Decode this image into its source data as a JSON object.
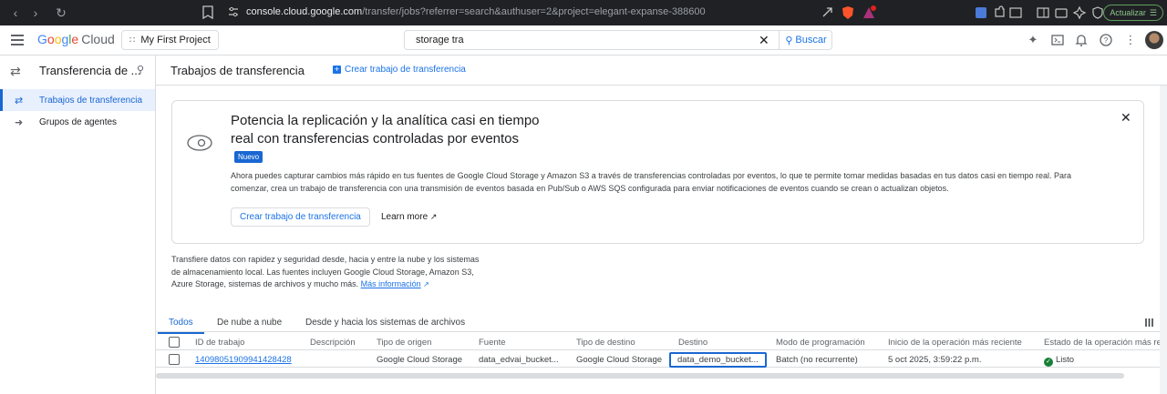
{
  "browser": {
    "url_host": "console.cloud.google.com",
    "url_path": "/transfer/jobs?referrer=search&authuser=2&project=elegant-expanse-388600",
    "update_label": "Actualizar"
  },
  "header": {
    "logo_google": "Google",
    "logo_cloud": "Cloud",
    "project": "My First Project",
    "search_value": "storage tra",
    "search_button": "Buscar"
  },
  "leftnav": {
    "title": "Transferencia de ...",
    "items": [
      {
        "label": "Trabajos de transferencia"
      },
      {
        "label": "Grupos de agentes"
      }
    ]
  },
  "page": {
    "title": "Trabajos de transferencia",
    "create_label": "Crear trabajo de transferencia"
  },
  "banner": {
    "title": "Potencia la replicación y la analítica casi en tiempo real con transferencias controladas por eventos",
    "badge": "Nuevo",
    "description": "Ahora puedes capturar cambios más rápido en tus fuentes de Google Cloud Storage y Amazon S3 a través de transferencias controladas por eventos, lo que te permite tomar medidas basadas en tus datos casi en tiempo real. Para comenzar, crea un trabajo de transferencia con una transmisión de eventos basada en Pub/Sub o AWS SQS configurada para enviar notificaciones de eventos cuando se crean o actualizan objetos.",
    "button": "Crear trabajo de transferencia",
    "learn_more": "Learn more"
  },
  "intro": {
    "text": "Transfiere datos con rapidez y seguridad desde, hacia y entre la nube y los sistemas de almacenamiento local. Las fuentes incluyen Google Cloud Storage, Amazon S3, Azure Storage, sistemas de archivos y mucho más.",
    "link": "Más información"
  },
  "tabs": [
    "Todos",
    "De nube a nube",
    "Desde y hacia los sistemas de archivos"
  ],
  "table": {
    "headers": [
      "ID de trabajo",
      "Descripción",
      "Tipo de origen",
      "Fuente",
      "Tipo de destino",
      "Destino",
      "Modo de programación",
      "Inicio de la operación más reciente",
      "Estado de la operación más re"
    ],
    "rows": [
      {
        "id": "14098051909941428428",
        "description": "",
        "source_type": "Google Cloud Storage",
        "source": "data_edvai_bucket...",
        "dest_type": "Google Cloud Storage",
        "dest": "data_demo_bucket...",
        "schedule": "Batch (no recurrente)",
        "start": "5 oct 2025, 3:59:22 p.m.",
        "status": "Listo"
      }
    ]
  },
  "colors": {
    "accent": "#1a73e8",
    "active_bg": "#e8f0fe",
    "success": "#188038"
  }
}
